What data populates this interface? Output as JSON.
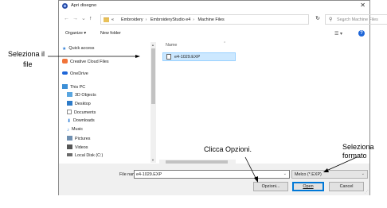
{
  "dialog": {
    "title": "Apri disegno",
    "close_glyph": "✕"
  },
  "nav": {
    "back": "←",
    "forward": "→",
    "recent": "⌄",
    "up": "↑",
    "breadcrumbs": [
      "«",
      "Embroidery",
      "EmbroideryStudio e4",
      "Machine Files"
    ],
    "address_dropdown": "⌄",
    "refresh": "↻",
    "search_placeholder": "Search Machine Files"
  },
  "commands": {
    "organize": "Organize ▾",
    "new_folder": "New folder",
    "help": "?"
  },
  "sidebar": {
    "items": [
      {
        "label": "Quick access",
        "icon": "star-icon",
        "color": "#2a7bd4"
      },
      {
        "label": "Creative Cloud Files",
        "icon": "creative-cloud-icon",
        "color": "#f1743a"
      },
      {
        "label": "OneDrive",
        "icon": "cloud-icon",
        "color": "#1e66d8"
      },
      {
        "label": "This PC",
        "icon": "computer-icon",
        "color": "#3c8fd6"
      },
      {
        "label": "3D Objects",
        "icon": "cube-icon",
        "color": "#5aa6e0"
      },
      {
        "label": "Desktop",
        "icon": "desktop-icon",
        "color": "#2e7bc8"
      },
      {
        "label": "Documents",
        "icon": "document-icon",
        "color": "#8a8a8a"
      },
      {
        "label": "Downloads",
        "icon": "download-icon",
        "color": "#2a7bd4"
      },
      {
        "label": "Music",
        "icon": "music-icon",
        "color": "#2a7bd4"
      },
      {
        "label": "Pictures",
        "icon": "pictures-icon",
        "color": "#6f8fb0"
      },
      {
        "label": "Videos",
        "icon": "video-icon",
        "color": "#555555"
      },
      {
        "label": "Local Disk (C:)",
        "icon": "disk-icon",
        "color": "#6a6a6a"
      }
    ]
  },
  "files": {
    "column_name": "Name",
    "items": [
      {
        "name": "e4-1029.EXP",
        "selected": true
      }
    ]
  },
  "bottom": {
    "file_name_label": "File name:",
    "file_name_value": "e4-1029.EXP",
    "file_type_value": "Melco (*.EXP)",
    "options_button": "Opzioni...",
    "open_button": "Open",
    "cancel_button": "Cancel"
  },
  "callouts": {
    "select_file_line1": "Seleziona il",
    "select_file_line2": "file",
    "click_options": "Clicca Opzioni.",
    "select_format_line1": "Seleziona",
    "select_format_line2": "formato"
  }
}
